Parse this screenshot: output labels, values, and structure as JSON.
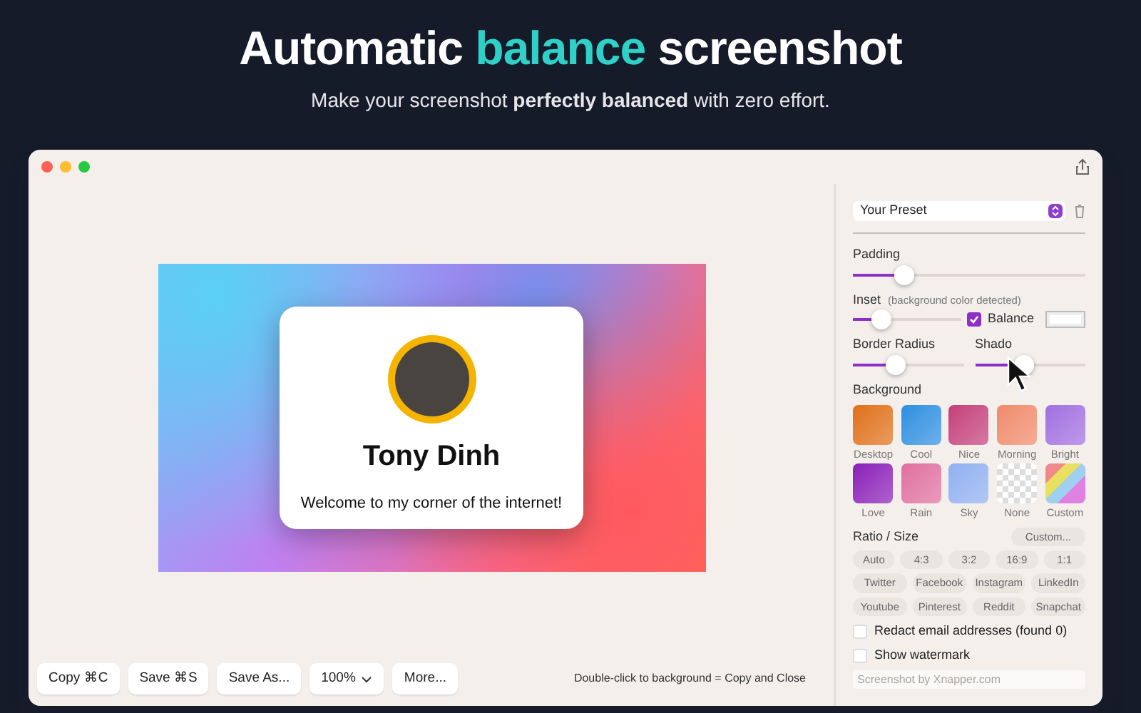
{
  "headline": {
    "before": "Automatic ",
    "highlight": "balance",
    "after": " screenshot"
  },
  "subtitle": "Make your screenshot **perfectly balanced** with zero effort.",
  "preview": {
    "name": "Tony Dinh",
    "tagline": "Welcome to my corner of the internet!"
  },
  "toolbar": {
    "buttons": [
      {
        "label": "Copy ⌘C",
        "kind": "plain"
      },
      {
        "label": "Save ⌘S",
        "kind": "plain"
      },
      {
        "label": "Save As...",
        "kind": "plain"
      },
      {
        "label": "100%",
        "kind": "dropdown"
      },
      {
        "label": "More...",
        "kind": "plain"
      }
    ],
    "hint": "Double-click to background = Copy and Close"
  },
  "sidebar": {
    "preset": "Your Preset",
    "padding": {
      "label": "Padding",
      "level": 0.18
    },
    "inset": {
      "label": "Inset",
      "note": "(background color detected)",
      "level": 0.17,
      "balance": {
        "label": "Balance",
        "checked": true
      }
    },
    "border_radius": {
      "label": "Border Radius",
      "level": 0.3
    },
    "shadow": {
      "label": "Shado",
      "level": 0.35
    },
    "background": {
      "label": "Background",
      "swatches": [
        {
          "label": "Desktop",
          "kind": "gradient",
          "color": "#e0701a"
        },
        {
          "label": "Cool",
          "kind": "gradient",
          "color": "#2e8fe0"
        },
        {
          "label": "Nice",
          "kind": "gradient",
          "color": "#c4407a"
        },
        {
          "label": "Morning",
          "kind": "gradient",
          "color": "#f08a6a"
        },
        {
          "label": "Bright",
          "kind": "gradient",
          "color": "#a070e0"
        },
        {
          "label": "Love",
          "kind": "gradient",
          "color": "#8a20b8"
        },
        {
          "label": "Rain",
          "kind": "gradient",
          "color": "#e070a0"
        },
        {
          "label": "Sky",
          "kind": "gradient",
          "color": "#90b0f0"
        },
        {
          "label": "None",
          "kind": "transparent"
        },
        {
          "label": "Custom",
          "kind": "stripes"
        }
      ]
    },
    "ratio": {
      "label": "Ratio / Size",
      "custom": "Custom...",
      "rows": [
        [
          "Auto",
          "4:3",
          "3:2",
          "16:9",
          "1:1"
        ],
        [
          "Twitter",
          "Facebook",
          "Instagram",
          "LinkedIn"
        ],
        [
          "Youtube",
          "Pinterest",
          "Reddit",
          "Snapchat"
        ]
      ]
    },
    "options": [
      {
        "label": "Redact email addresses (found 0)",
        "checked": false
      },
      {
        "label": "Show watermark",
        "checked": false
      }
    ],
    "watermark": {
      "placeholder": "Screenshot by Xnapper.com"
    }
  }
}
